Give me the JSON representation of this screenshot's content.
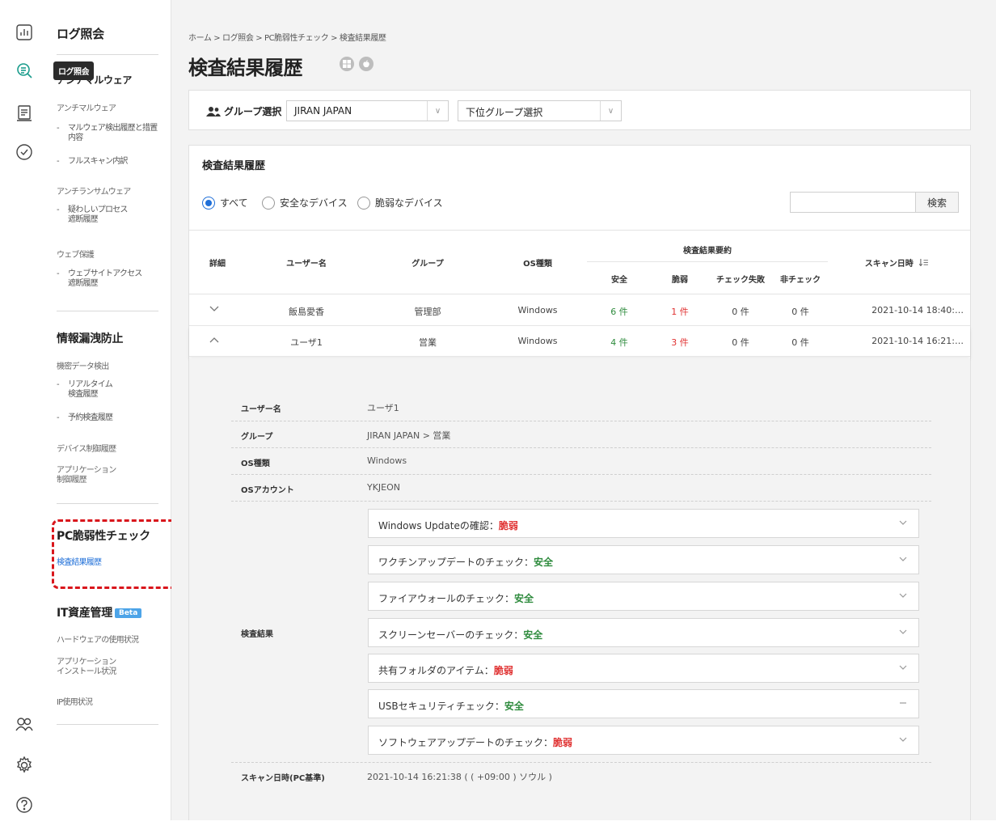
{
  "rail": {
    "icons": [
      "dashboard-icon",
      "log-search-icon",
      "report-icon",
      "check-circle-icon",
      "users-icon",
      "settings-icon",
      "help-icon"
    ]
  },
  "tooltip": "ログ照会",
  "sidebar": {
    "title": "ログ照会",
    "sub_title": "アンチマルウェア",
    "groups": [
      "アンチマルウェア",
      "アンチランサムウェア",
      "ウェブ保護",
      "機密データ検出",
      "デバイス制御履歴",
      "アプリケーション",
      "制御履歴",
      "ハードウェアの使用状況",
      "アプリケーション",
      "インストール状況",
      "IP使用状況"
    ],
    "items": [
      "マルウェア検出履歴と措置",
      "内容",
      "フルスキャン内訳",
      "疑わしいプロセス",
      "遮断履歴",
      "ウェブサイトアクセス",
      "遮断履歴",
      "リアルタイム",
      "検査履歴",
      "予約検査履歴"
    ],
    "sections": [
      "情報漏洩防止",
      "PC脆弱性チェック",
      "IT資産管理"
    ],
    "beta": "Beta",
    "active_link": "検査結果履歴",
    "dash": "-"
  },
  "main": {
    "breadcrumb": "ホーム > ログ照会 > PC脆弱性チェック > 検査結果履歴",
    "title": "検査結果履歴",
    "os_badges": [
      "windows-icon",
      "apple-icon"
    ],
    "group_select_label": "グループ選択",
    "group_value": "JIRAN JAPAN",
    "subgroup_value": "下位グループ選択",
    "card_title": "検査結果履歴",
    "filters": [
      "すべて",
      "安全なデバイス",
      "脆弱なデバイス"
    ],
    "search_placeholder": "",
    "search_button": "検索",
    "columns": {
      "detail": "詳細",
      "user": "ユーザー名",
      "group": "グループ",
      "os": "OS種類",
      "summary": "検査結果要約",
      "safe": "安全",
      "vuln": "脆弱",
      "fail": "チェック失敗",
      "unchecked": "非チェック",
      "scan_time": "スキャン日時"
    },
    "rows": [
      {
        "user": "飯島愛香",
        "group": "管理部",
        "os": "Windows",
        "safe": "6 件",
        "vuln": "1 件",
        "fail": "0 件",
        "unchecked": "0 件",
        "time": "2021-10-14 18:40:…"
      },
      {
        "user": "ユーザ1",
        "group": "営業",
        "os": "Windows",
        "safe": "4 件",
        "vuln": "3 件",
        "fail": "0 件",
        "unchecked": "0 件",
        "time": "2021-10-14 16:21:…"
      }
    ],
    "detail": {
      "labels": {
        "user": "ユーザー名",
        "group": "グループ",
        "os": "OS種類",
        "account": "OSアカウント",
        "results": "検査結果",
        "scan": "スキャン日時(PC基準)"
      },
      "values": {
        "user": "ユーザ1",
        "group": "JIRAN JAPAN > 営業",
        "os": "Windows",
        "account": "YKJEON",
        "scan": "2021-10-14 16:21:38 ( ( +09:00 ) ソウル )"
      },
      "checks": [
        {
          "label": "Windows Updateの確認：",
          "status": "脆弱"
        },
        {
          "label": "ワクチンアップデートのチェック：",
          "status": "安全"
        },
        {
          "label": "ファイアウォールのチェック：",
          "status": "安全"
        },
        {
          "label": "スクリーンセーバーのチェック：",
          "status": "安全"
        },
        {
          "label": "共有フォルダのアイテム：",
          "status": "脆弱"
        },
        {
          "label": "USBセキュリティチェック：",
          "status": "安全"
        },
        {
          "label": "ソフトウェアアップデートのチェック：",
          "status": "脆弱"
        }
      ]
    }
  },
  "colors": {
    "accent": "#1f6fd8",
    "safe": "#2e8b3d",
    "vuln": "#e03131",
    "highlight": "#d9161c"
  }
}
